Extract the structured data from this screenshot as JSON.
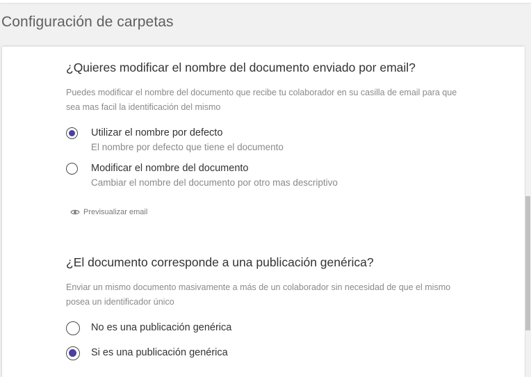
{
  "page": {
    "title": "Configuración de carpetas"
  },
  "rename_section": {
    "title": "¿Quieres modificar el nombre del documento enviado por email?",
    "description": "Puedes modificar el nombre del documento que recibe tu colaborador en su casilla de email para que sea mas facil la identificación del mismo",
    "options": [
      {
        "label": "Utilizar el nombre por defecto",
        "sublabel": "El nombre por defecto que tiene el documento",
        "selected": true
      },
      {
        "label": "Modificar el nombre del documento",
        "sublabel": "Cambiar el nombre del documento por otro mas descriptivo",
        "selected": false
      }
    ],
    "preview_link": "Previsualizar email"
  },
  "generic_section": {
    "title": "¿El documento corresponde a una publicación genérica?",
    "description": "Enviar un mismo documento masivamente a más de un colaborador sin necesidad de que el mismo posea un identificador único",
    "options": [
      {
        "label": "No es una publicación genérica",
        "selected": false
      },
      {
        "label": "Si es una publicación genérica",
        "selected": true
      }
    ]
  },
  "colors": {
    "accent": "#4a3fa3",
    "title_text": "#333333",
    "muted_text": "#8a8a8a",
    "background": "#f1f1f1",
    "card": "#ffffff"
  },
  "icons": {
    "preview": "eye-icon"
  }
}
